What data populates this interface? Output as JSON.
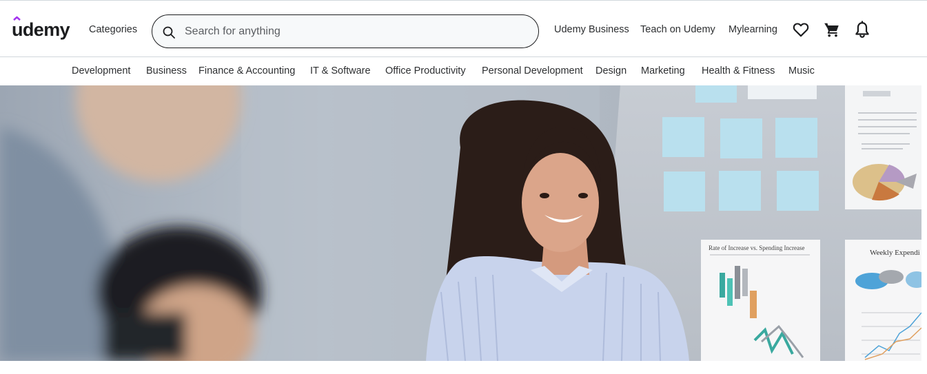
{
  "header": {
    "logo_text": "udemy",
    "categories_label": "Categories",
    "search": {
      "placeholder": "Search for anything",
      "value": ""
    },
    "links": {
      "business": "Udemy Business",
      "teach": "Teach on Udemy",
      "my_learning": "Mylearning"
    },
    "icons": [
      "search-icon",
      "heart-icon",
      "cart-icon",
      "bell-icon"
    ]
  },
  "categories": [
    "Development",
    "Business",
    "Finance & Accounting",
    "IT & Software",
    "Office Productivity",
    "Personal Development",
    "Design",
    "Marketing",
    "Health & Fitness",
    "Music"
  ],
  "hero": {
    "image": "banner-photo-smiling-woman-office",
    "poster_titles": [
      "Rate of Increase vs. Spending Increase",
      "Weekly Expendi"
    ]
  },
  "colors": {
    "brand_purple": "#a435f0",
    "text": "#2d2f31",
    "border": "#d1d7dc",
    "search_bg": "#f7f9fa"
  }
}
